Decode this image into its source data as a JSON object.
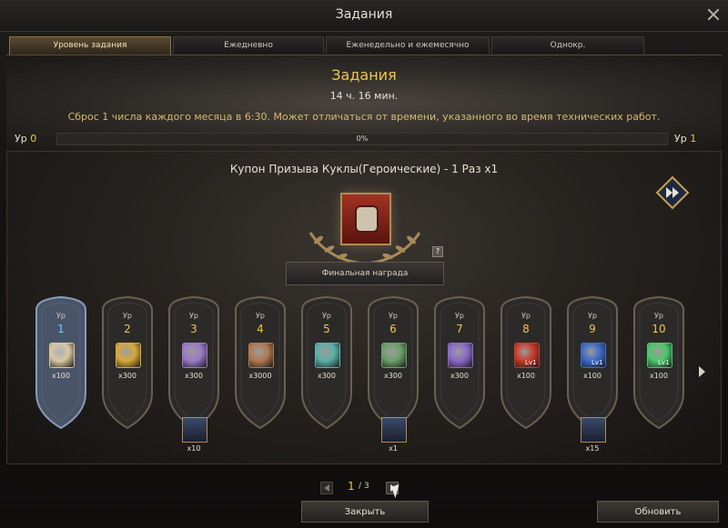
{
  "window": {
    "title": "Задания"
  },
  "tabs": [
    {
      "label": "Уровень задания",
      "active": true
    },
    {
      "label": "Ежедневно",
      "active": false
    },
    {
      "label": "Еженедельно и ежемесячно",
      "active": false
    },
    {
      "label": "Однокр.",
      "active": false
    }
  ],
  "banner": {
    "title": "Задания",
    "time_left": "14 ч. 16 мин.",
    "note": "Сброс 1 числа каждого месяца в 6:30. Может отличаться от времени, указанного во время технических работ."
  },
  "level": {
    "prefix": "Ур",
    "current": "0",
    "next": "1",
    "progress_text": "0%",
    "progress_fraction": 0.0
  },
  "reward": {
    "title": "Купон Призыва Куклы(Героические) - 1 Раз x1",
    "final_label": "Финальная награда",
    "help": "?"
  },
  "tiers": [
    {
      "ur": "Ур",
      "level": "1",
      "qty": "x100",
      "color": "#d8c8a0",
      "current": true
    },
    {
      "ur": "Ур",
      "level": "2",
      "qty": "x300",
      "color": "#d8a93a"
    },
    {
      "ur": "Ур",
      "level": "3",
      "qty": "x300",
      "color": "#9a7ac8",
      "bonus_qty": "x10"
    },
    {
      "ur": "Ур",
      "level": "4",
      "qty": "x3000",
      "color": "#b07850"
    },
    {
      "ur": "Ур",
      "level": "5",
      "qty": "x300",
      "color": "#5ab0a8"
    },
    {
      "ur": "Ур",
      "level": "6",
      "qty": "x300",
      "color": "#6aa06a",
      "bonus_qty": "x1"
    },
    {
      "ur": "Ур",
      "level": "7",
      "qty": "x300",
      "color": "#8a6ac8"
    },
    {
      "ur": "Ур",
      "level": "8",
      "qty": "x100",
      "color": "#c83a2a",
      "badge": "Lv1"
    },
    {
      "ur": "Ур",
      "level": "9",
      "qty": "x100",
      "color": "#3a6ac8",
      "badge": "Lv1",
      "bonus_qty": "x15"
    },
    {
      "ur": "Ур",
      "level": "10",
      "qty": "x100",
      "color": "#4ac86a",
      "badge": "Lv1"
    }
  ],
  "pager": {
    "current": "1",
    "separator": "/",
    "total": "3"
  },
  "buttons": {
    "close": "Закрыть",
    "refresh": "Обновить"
  }
}
